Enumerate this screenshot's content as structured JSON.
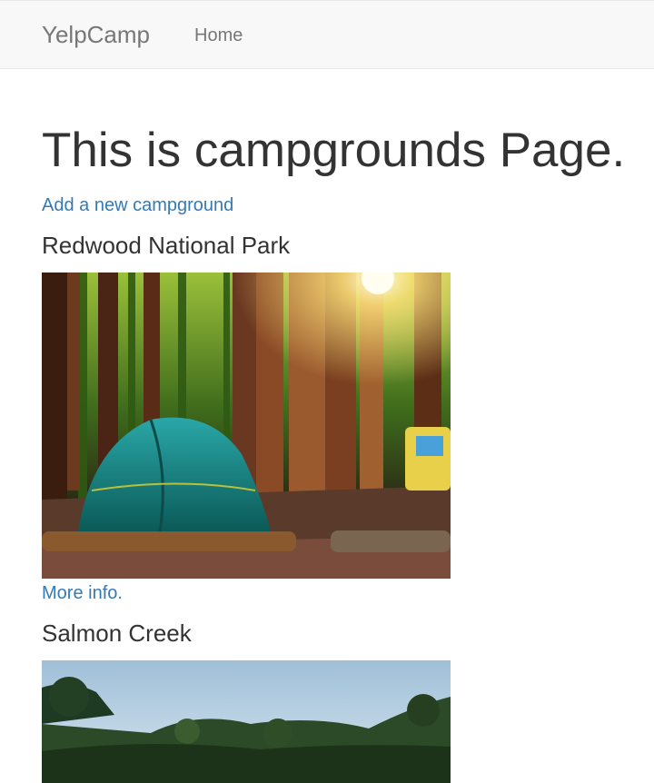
{
  "navbar": {
    "brand": "YelpCamp",
    "links": [
      {
        "label": "Home"
      }
    ]
  },
  "main": {
    "title": "This is campgrounds Page.",
    "add_link": "Add a new campground",
    "campgrounds": [
      {
        "name": "Redwood National Park",
        "more_link": "More info."
      },
      {
        "name": "Salmon Creek"
      }
    ]
  },
  "colors": {
    "link": "#337ab7",
    "navbar_bg": "#f8f8f8",
    "nav_text": "#777777",
    "text": "#333333"
  }
}
